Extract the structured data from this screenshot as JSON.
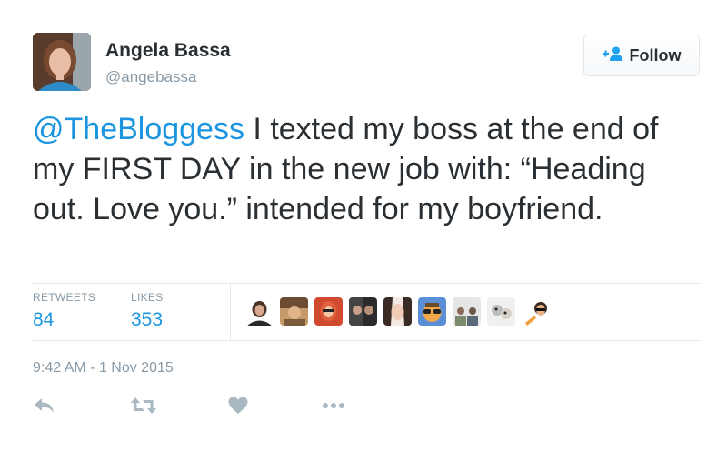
{
  "user": {
    "name": "Angela Bassa",
    "handle": "@angebassa"
  },
  "follow_button": {
    "label": "Follow"
  },
  "tweet": {
    "mention": "@TheBloggess",
    "body": " I texted my boss at the end of my FIRST DAY in the new job with: “Heading out. Love you.” intended for my boyfriend."
  },
  "stats": {
    "retweets_label": "RETWEETS",
    "retweets_value": "84",
    "likes_label": "LIKES",
    "likes_value": "353"
  },
  "likers_count_shown": 9,
  "timestamp": "9:42 AM - 1 Nov 2015",
  "actions": [
    "reply-icon",
    "retweet-icon",
    "like-icon",
    "more-icon"
  ],
  "colors": {
    "link": "#1b95e0",
    "text": "#292f33",
    "muted": "#8899a6",
    "divider": "#e1e8ed"
  }
}
